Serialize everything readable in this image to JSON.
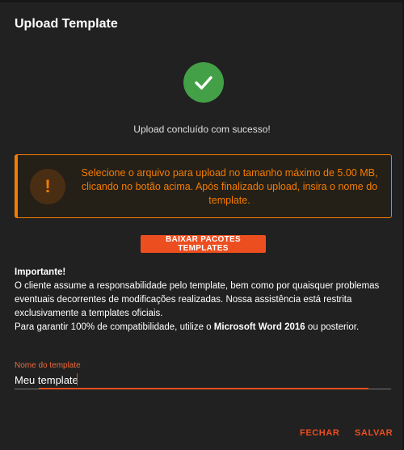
{
  "dialog": {
    "title": "Upload Template"
  },
  "status": {
    "icon": "check-icon",
    "color": "#43a047",
    "message": "Upload concluído com sucesso!"
  },
  "warning": {
    "icon": "exclamation-icon",
    "color": "#f57c00",
    "message": "Selecione o arquivo para upload no tamanho máximo de 5.00 MB, clicando no botão acima. Após finalizado upload, insira o nome do template."
  },
  "download_button": {
    "label": "BAIXAR PACOTES TEMPLATES",
    "color": "#ec4e20"
  },
  "important": {
    "heading": "Importante!",
    "line1": "O cliente assume a responsabilidade pelo template, bem como por quaisquer problemas eventuais decorrentes de modificações realizadas. Nossa assistência está restrita exclusivamente a templates oficiais.",
    "line2_prefix": "Para garantir 100% de compatibilidade, utilize o ",
    "line2_bold": "Microsoft Word 2016",
    "line2_suffix": " ou posterior."
  },
  "template_name": {
    "label": "Nome do template",
    "value": "Meu template"
  },
  "actions": {
    "close_label": "FECHAR",
    "save_label": "SALVAR"
  }
}
